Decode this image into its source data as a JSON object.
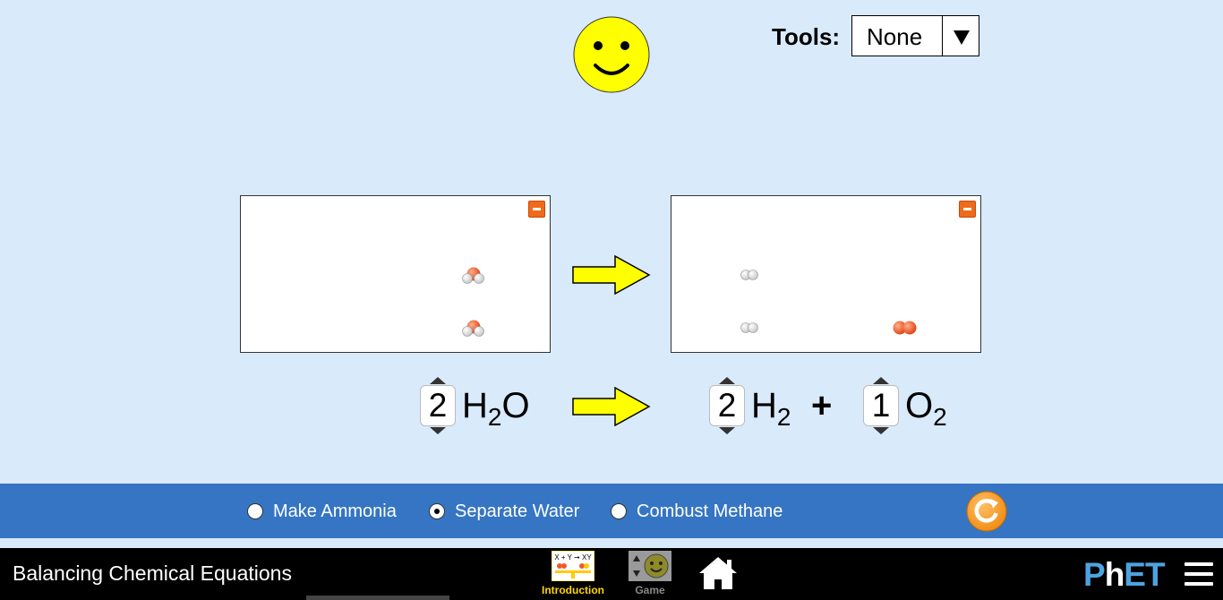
{
  "tools": {
    "label": "Tools:",
    "selected": "None"
  },
  "equation": {
    "reactants": [
      {
        "coefficient": "2",
        "formula": {
          "base": "H",
          "sub": "2",
          "tail": "O"
        }
      }
    ],
    "products": [
      {
        "coefficient": "2",
        "formula": {
          "base": "H",
          "sub": "2",
          "tail": ""
        }
      },
      {
        "coefficient": "1",
        "formula": {
          "base": "O",
          "sub": "2",
          "tail": ""
        }
      }
    ],
    "plus": "+"
  },
  "boxes": {
    "reactant_molecules": [
      "water",
      "water"
    ],
    "product_molecules": [
      "hydrogen",
      "hydrogen",
      "oxygen"
    ]
  },
  "reactions": {
    "options": [
      "Make Ammonia",
      "Separate Water",
      "Combust Methane"
    ],
    "selected": "Separate Water"
  },
  "navbar": {
    "title": "Balancing Chemical Equations",
    "screens": [
      {
        "label": "Introduction",
        "icon_text": "X + Y ➞ XY",
        "active": true
      },
      {
        "label": "Game",
        "active": false
      }
    ],
    "logo": {
      "p": "P",
      "h": "h",
      "et": "ET"
    }
  },
  "colors": {
    "background": "#d9eafb",
    "control_bar": "#3575c4",
    "arrow_fill": "#ffff00",
    "oxygen": "#ef5a2a",
    "hydrogen": "#ffffff",
    "smiley": "#ffff00",
    "reset": "#f7941d"
  }
}
